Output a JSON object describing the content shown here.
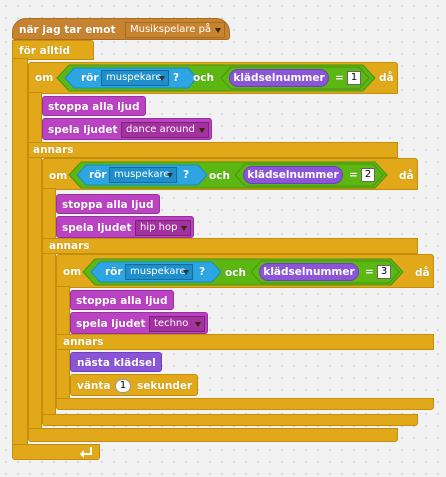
{
  "hat": {
    "text": "när jag tar emot",
    "message": "Musikspelare på"
  },
  "forever": {
    "label": "för alltid"
  },
  "if1": {
    "if_label": "om",
    "touching": "rör",
    "touch_target": "muspekare",
    "question": "?",
    "and": "och",
    "costume_reporter": "klädselnummer",
    "equals": "=",
    "value": "1",
    "then": "då",
    "stop_label": "stoppa alla ljud",
    "play_label": "spela ljudet",
    "sound": "dance around",
    "else_label": "annars"
  },
  "if2": {
    "if_label": "om",
    "touching": "rör",
    "touch_target": "muspekare",
    "question": "?",
    "and": "och",
    "costume_reporter": "klädselnummer",
    "equals": "=",
    "value": "2",
    "then": "då",
    "stop_label": "stoppa alla ljud",
    "play_label": "spela ljudet",
    "sound": "hip hop",
    "else_label": "annars"
  },
  "if3": {
    "if_label": "om",
    "touching": "rör",
    "touch_target": "muspekare",
    "question": "?",
    "and": "och",
    "costume_reporter": "klädselnummer",
    "equals": "=",
    "value": "3",
    "then": "då",
    "stop_label": "stoppa alla ljud",
    "play_label": "spela ljudet",
    "sound": "techno",
    "else_label": "annars",
    "next_costume": "nästa klädsel",
    "wait_label": "vänta",
    "wait_value": "1",
    "seconds": "sekunder"
  },
  "colors": {
    "events": "#c88330",
    "control": "#e1a91a",
    "sound": "#bb42c3",
    "looks": "#8a55d7",
    "operators": "#5cb712",
    "sensing": "#2ca5e2"
  },
  "icons": {
    "loop": "loop-arrow-icon",
    "dropdown": "dropdown-arrow-icon"
  }
}
